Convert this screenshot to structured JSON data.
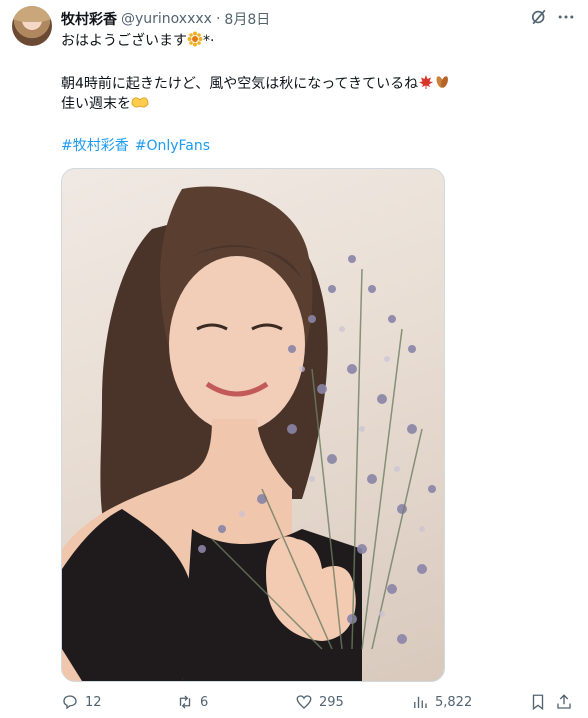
{
  "tweet": {
    "author_name": "牧村彩香",
    "handle": "@yurinoxxxx",
    "separator": "·",
    "date": "8月8日",
    "line1": "おはようございます",
    "line1_tail": "*·",
    "line2": "朝4時前に起きたけど、風や空気は秋になってきているね",
    "line3": "佳い週末を",
    "hashtags": [
      "#牧村彩香",
      "#OnlyFans"
    ]
  },
  "actions": {
    "replies": "12",
    "reposts": "6",
    "likes": "295",
    "views": "5,822"
  },
  "icons": {
    "grok": "grok-icon",
    "more": "more-icon",
    "reply": "reply-icon",
    "repost": "repost-icon",
    "like": "heart-icon",
    "views": "views-icon",
    "bookmark": "bookmark-icon",
    "share": "share-icon"
  },
  "colors": {
    "link": "#1d9bf0",
    "muted": "#536471",
    "text": "#0f1419"
  }
}
